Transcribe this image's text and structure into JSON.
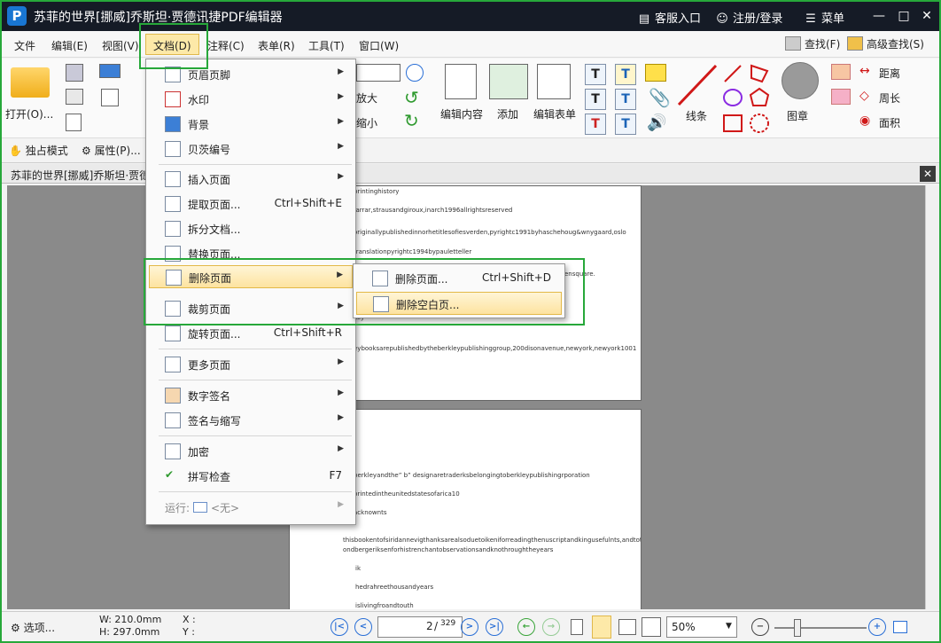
{
  "titlebar": {
    "title": "苏菲的世界[挪威]乔斯坦·贾德讯捷PDF编辑器",
    "logo_letter": "P",
    "support_label": "客服入口",
    "login_label": "注册/登录",
    "menu_label": "菜单"
  },
  "menubar": {
    "items": [
      "文件",
      "编辑(E)",
      "视图(V)",
      "文档(D)",
      "注释(C)",
      "表单(R)",
      "工具(T)",
      "窗口(W)"
    ],
    "find_label": "查找(F)",
    "advanced_find_label": "高级查找(S)"
  },
  "ribbon": {
    "open_label": "打开(O)...",
    "zoom_in_label": "放大",
    "zoom_out_label": "缩小",
    "edit_content_label": "编辑内容",
    "add_label": "添加",
    "edit_form_label": "编辑表单",
    "lines_label": "线条",
    "stamp_label": "图章",
    "distance_label": "距离",
    "perimeter_label": "周长",
    "area_label": "面积"
  },
  "subbar": {
    "exclusive_mode_label": "独占模式",
    "properties_label": "属性(P)..."
  },
  "document_tab": {
    "label": "苏菲的世界[挪威]乔斯坦·贾德"
  },
  "doc_menu": {
    "items": [
      {
        "label": "页眉页脚",
        "shortcut": "",
        "submenu": true
      },
      {
        "label": "水印",
        "shortcut": "",
        "submenu": true
      },
      {
        "label": "背景",
        "shortcut": "",
        "submenu": true
      },
      {
        "label": "贝茨编号",
        "shortcut": "",
        "submenu": true
      },
      {
        "label": "插入页面",
        "shortcut": "",
        "submenu": true
      },
      {
        "label": "提取页面...",
        "shortcut": "Ctrl+Shift+E",
        "submenu": false
      },
      {
        "label": "拆分文档...",
        "shortcut": "",
        "submenu": false
      },
      {
        "label": "替换页面...",
        "shortcut": "",
        "submenu": false
      },
      {
        "label": "删除页面",
        "shortcut": "",
        "submenu": true
      },
      {
        "label": "裁剪页面",
        "shortcut": "",
        "submenu": true
      },
      {
        "label": "旋转页面...",
        "shortcut": "Ctrl+Shift+R",
        "submenu": false
      },
      {
        "label": "更多页面",
        "shortcut": "",
        "submenu": true
      },
      {
        "label": "数字签名",
        "shortcut": "",
        "submenu": true
      },
      {
        "label": "签名与缩写",
        "shortcut": "",
        "submenu": true
      },
      {
        "label": "加密",
        "shortcut": "",
        "submenu": true
      },
      {
        "label": "拼写检查",
        "shortcut": "F7",
        "submenu": false
      }
    ],
    "run_label": "运行:",
    "run_value": "<无>"
  },
  "delete_submenu": {
    "items": [
      {
        "label": "删除页面...",
        "shortcut": "Ctrl+Shift+D"
      },
      {
        "label": "删除空白页..."
      }
    ]
  },
  "page1_lines": [
    "printinghistory",
    "farrar,strausandgiroux,inarch1996allrightsreserved",
    "originallypublishedinnorhetitlesofiesverden,pyrightc1991byhaschehoug&wnygaard,oslo",
    "translationpyrightc1994bypauletteller",
    "ensquare.",
    "key",
    "eybooksarepublishedbytheberkleypublishinggroup,200disonavenue,newyork,newyork1001"
  ],
  "page2_lines": [
    "berkleyandthe” b” designaretraderksbelongingtoberkleypublishingrporation",
    "printedintheunitedstatesofarica10",
    "acknownts",
    "thisbookentofsiridannevigthanksarealsoduetoikeniforreadingthenuscriptandkingusefulnts,andtotr",
    "ondbergeriksenforhistrenchantobservationsandknothroughtheyears",
    "ik",
    "hedrahreethousandyears",
    "islivingfroandtouth"
  ],
  "statusbar": {
    "select_label": "选项...",
    "width_text": "W: 210.0mm",
    "height_text": "H: 297.0mm",
    "x_text": "X :",
    "y_text": "Y :",
    "current_page": "2",
    "total_pages": "329",
    "zoom_value": "50%"
  }
}
